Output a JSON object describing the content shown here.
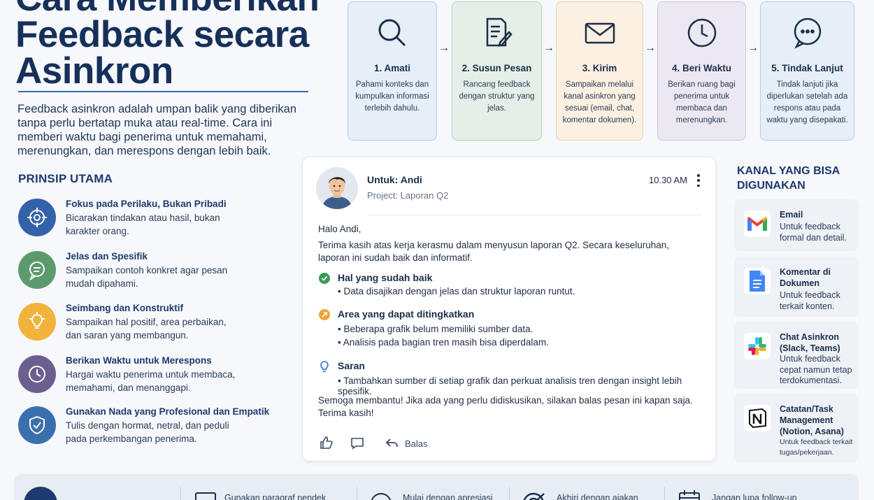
{
  "header": {
    "title": "Cara Memberikan Feedback secara Asinkron",
    "intro": "Feedback asinkron adalah umpan balik yang diberikan tanpa perlu bertatap muka atau real-time. Cara ini memberi waktu bagi penerima untuk memahami, merenungkan, dan merespons dengan lebih baik."
  },
  "principles": {
    "heading": "PRINSIP UTAMA",
    "items": [
      {
        "title": "Fokus pada Perilaku, Bukan Pribadi",
        "desc": "Bicarakan tindakan atau hasil, bukan karakter orang.",
        "icon": "target-icon",
        "color": "#3461a8"
      },
      {
        "title": "Jelas dan Spesifik",
        "desc": "Sampaikan contoh konkret agar pesan mudah dipahami.",
        "icon": "chat-bubble-icon",
        "color": "#5c9a6e"
      },
      {
        "title": "Seimbang dan Konstruktif",
        "desc": "Sampaikan hal positif, area perbaikan, dan saran yang membangun.",
        "icon": "lightbulb-icon",
        "color": "#f2b33d"
      },
      {
        "title": "Berikan Waktu untuk Merespons",
        "desc": "Hargai waktu penerima untuk membaca, memahami, dan menanggapi.",
        "icon": "clock-icon",
        "color": "#6b5f8f"
      },
      {
        "title": "Gunakan Nada yang Profesional dan Empatik",
        "desc": "Tulis dengan hormat, netral, dan peduli pada perkembangan penerima.",
        "icon": "shield-check-icon",
        "color": "#3a6fae"
      }
    ]
  },
  "steps": [
    {
      "title": "1. Amati",
      "desc": "Pahami konteks dan kumpulkan informasi terlebih dahulu.",
      "icon": "search-icon",
      "bg": "#e6eef8",
      "border": "#b9cce6"
    },
    {
      "title": "2. Susun Pesan",
      "desc": "Rancang feedback dengan struktur yang jelas.",
      "icon": "document-edit-icon",
      "bg": "#e5efe7",
      "border": "#b7d1bd"
    },
    {
      "title": "3. Kirim",
      "desc": "Sampaikan melalui kanal asinkron yang sesuai (email, chat, komentar dokumen).",
      "icon": "envelope-icon",
      "bg": "#fbf0e1",
      "border": "#ecd2ac"
    },
    {
      "title": "4. Beri Waktu",
      "desc": "Berikan ruang bagi penerima untuk membaca dan merenungkan.",
      "icon": "clock-icon",
      "bg": "#ece8f2",
      "border": "#cdc4dc"
    },
    {
      "title": "5. Tindak Lanjut",
      "desc": "Tindak lanjuti jika diperlukan setelah ada respons atau pada waktu yang disepakati.",
      "icon": "chat-dots-icon",
      "bg": "#e6eef8",
      "border": "#b9cce6"
    }
  ],
  "message": {
    "to": "Untuk: Andi",
    "project": "Project: Laporan Q2",
    "time": "10.30 AM",
    "greeting": "Halo Andi,",
    "opening": "Terima kasih atas kerja kerasmu dalam menyusun laporan Q2. Secara keseluruhan, laporan ini sudah baik dan informatif.",
    "good_title": "Hal yang sudah baik",
    "good_items": [
      "Data disajikan dengan jelas dan struktur laporan runtut."
    ],
    "improve_title": "Area yang dapat ditingkatkan",
    "improve_items": [
      "Beberapa grafik belum memiliki sumber data.",
      "Analisis pada bagian tren masih bisa diperdalam."
    ],
    "suggest_title": "Saran",
    "suggest_items": [
      "Tambahkan sumber di setiap grafik dan perkuat analisis tren dengan insight lebih spesifik."
    ],
    "closing": "Semoga membantu! Jika ada yang perlu didiskusikan, silakan balas pesan ini kapan saja. Terima kasih!",
    "reply_label": "Balas"
  },
  "channels": {
    "heading": "KANAL YANG BISA DIGUNAKAN",
    "items": [
      {
        "title": "Email",
        "desc": "Untuk feedback formal dan detail.",
        "icon": "gmail-icon"
      },
      {
        "title": "Komentar di Dokumen",
        "desc": "Untuk feedback terkait konten.",
        "icon": "google-docs-icon"
      },
      {
        "title": "Chat Asinkron (Slack, Teams)",
        "desc": "Untuk feedback cepat namun tetap terdokumentasi.",
        "icon": "slack-icon"
      },
      {
        "title": "Catatan/Task Management (Notion, Asana)",
        "desc": "Untuk feedback terkait tugas/pekerjaan.",
        "icon": "notion-icon"
      }
    ]
  },
  "tips": [
    {
      "label": "Gunakan paragraf pendek",
      "icon": "paragraph-icon"
    },
    {
      "label": "Mulai dengan apresiasi",
      "icon": "smile-icon"
    },
    {
      "label": "Akhiri dengan ajakan",
      "icon": "target-arrow-icon"
    },
    {
      "label": "Jangan lupa follow-up",
      "icon": "calendar-icon"
    }
  ]
}
